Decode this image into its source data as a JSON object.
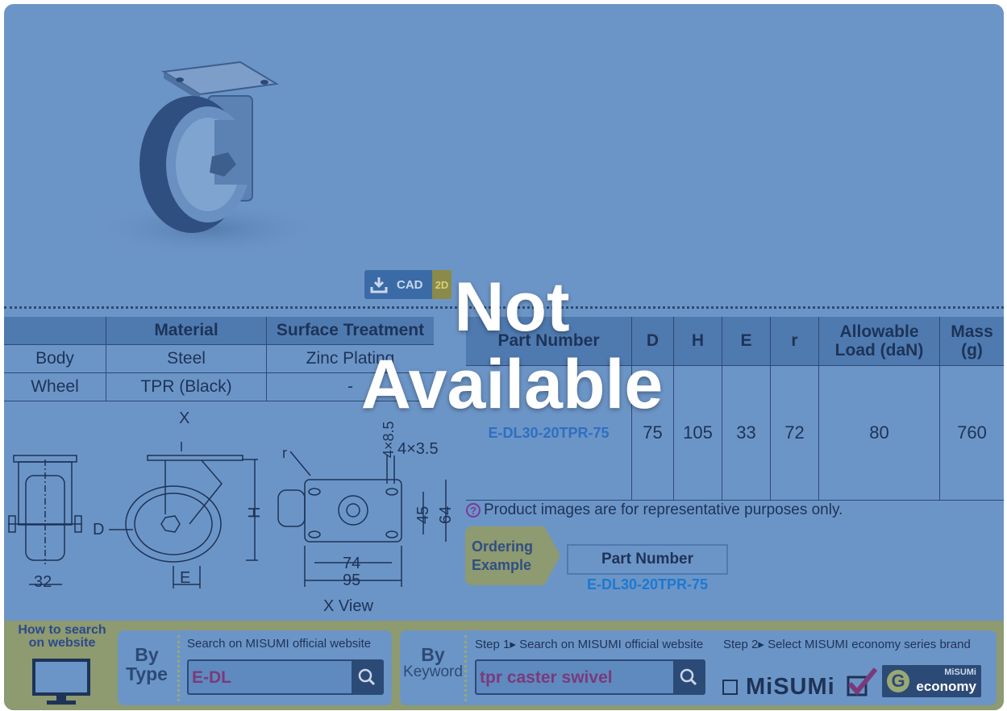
{
  "cad": {
    "label": "CAD",
    "badge": "2D",
    "icon": "download-icon"
  },
  "material_table": {
    "headers": [
      "",
      "Material",
      "Surface Treatment"
    ],
    "rows": [
      [
        "Body",
        "Steel",
        "Zinc Plating"
      ],
      [
        "Wheel",
        "TPR (Black)",
        "-"
      ]
    ]
  },
  "spec_table": {
    "headers": [
      "Part Number",
      "D",
      "H",
      "E",
      "r",
      "Allowable\nLoad (daN)",
      "Mass\n(g)"
    ],
    "rows": [
      [
        "E-DL30-20TPR-75",
        "75",
        "105",
        "33",
        "72",
        "80",
        "760"
      ]
    ]
  },
  "drawing": {
    "labels": {
      "x": "X",
      "d": "D",
      "h": "H",
      "r": "r",
      "e": "E",
      "dim32": "32",
      "hole": "4×3.5",
      "dim45": "45",
      "dim64": "64",
      "dim74": "74",
      "dim95": "95",
      "dim85": "4×8.5",
      "view": "X View"
    }
  },
  "disclaimer": "Product images are for representative purposes only.",
  "ordering": {
    "label_line1": "Ordering",
    "label_line2": "Example",
    "pn_header": "Part Number",
    "pn_value": "E-DL30-20TPR-75"
  },
  "search": {
    "how_to_line1": "How to search",
    "how_to_line2": "on website",
    "by_type": {
      "by": "By",
      "type": "Type",
      "label": "Search on MISUMI official website",
      "value": "E-DL"
    },
    "by_keyword": {
      "by": "By",
      "keyword": "Keyword",
      "step1": "Step 1▸ Search on MISUMI official website",
      "step2": "Step 2▸ Select MISUMI economy series brand",
      "value": "tpr caster swivel"
    },
    "misumi_brand": "MiSUMi",
    "economy_top": "MiSUMi",
    "economy_bottom": "economy"
  },
  "overlay": {
    "line1": "Not",
    "line2": "Available"
  },
  "colors": {
    "background": "#6c95c7",
    "header": "#4f7ab0",
    "accent": "#8e9a6f",
    "link": "#1c79d0"
  }
}
